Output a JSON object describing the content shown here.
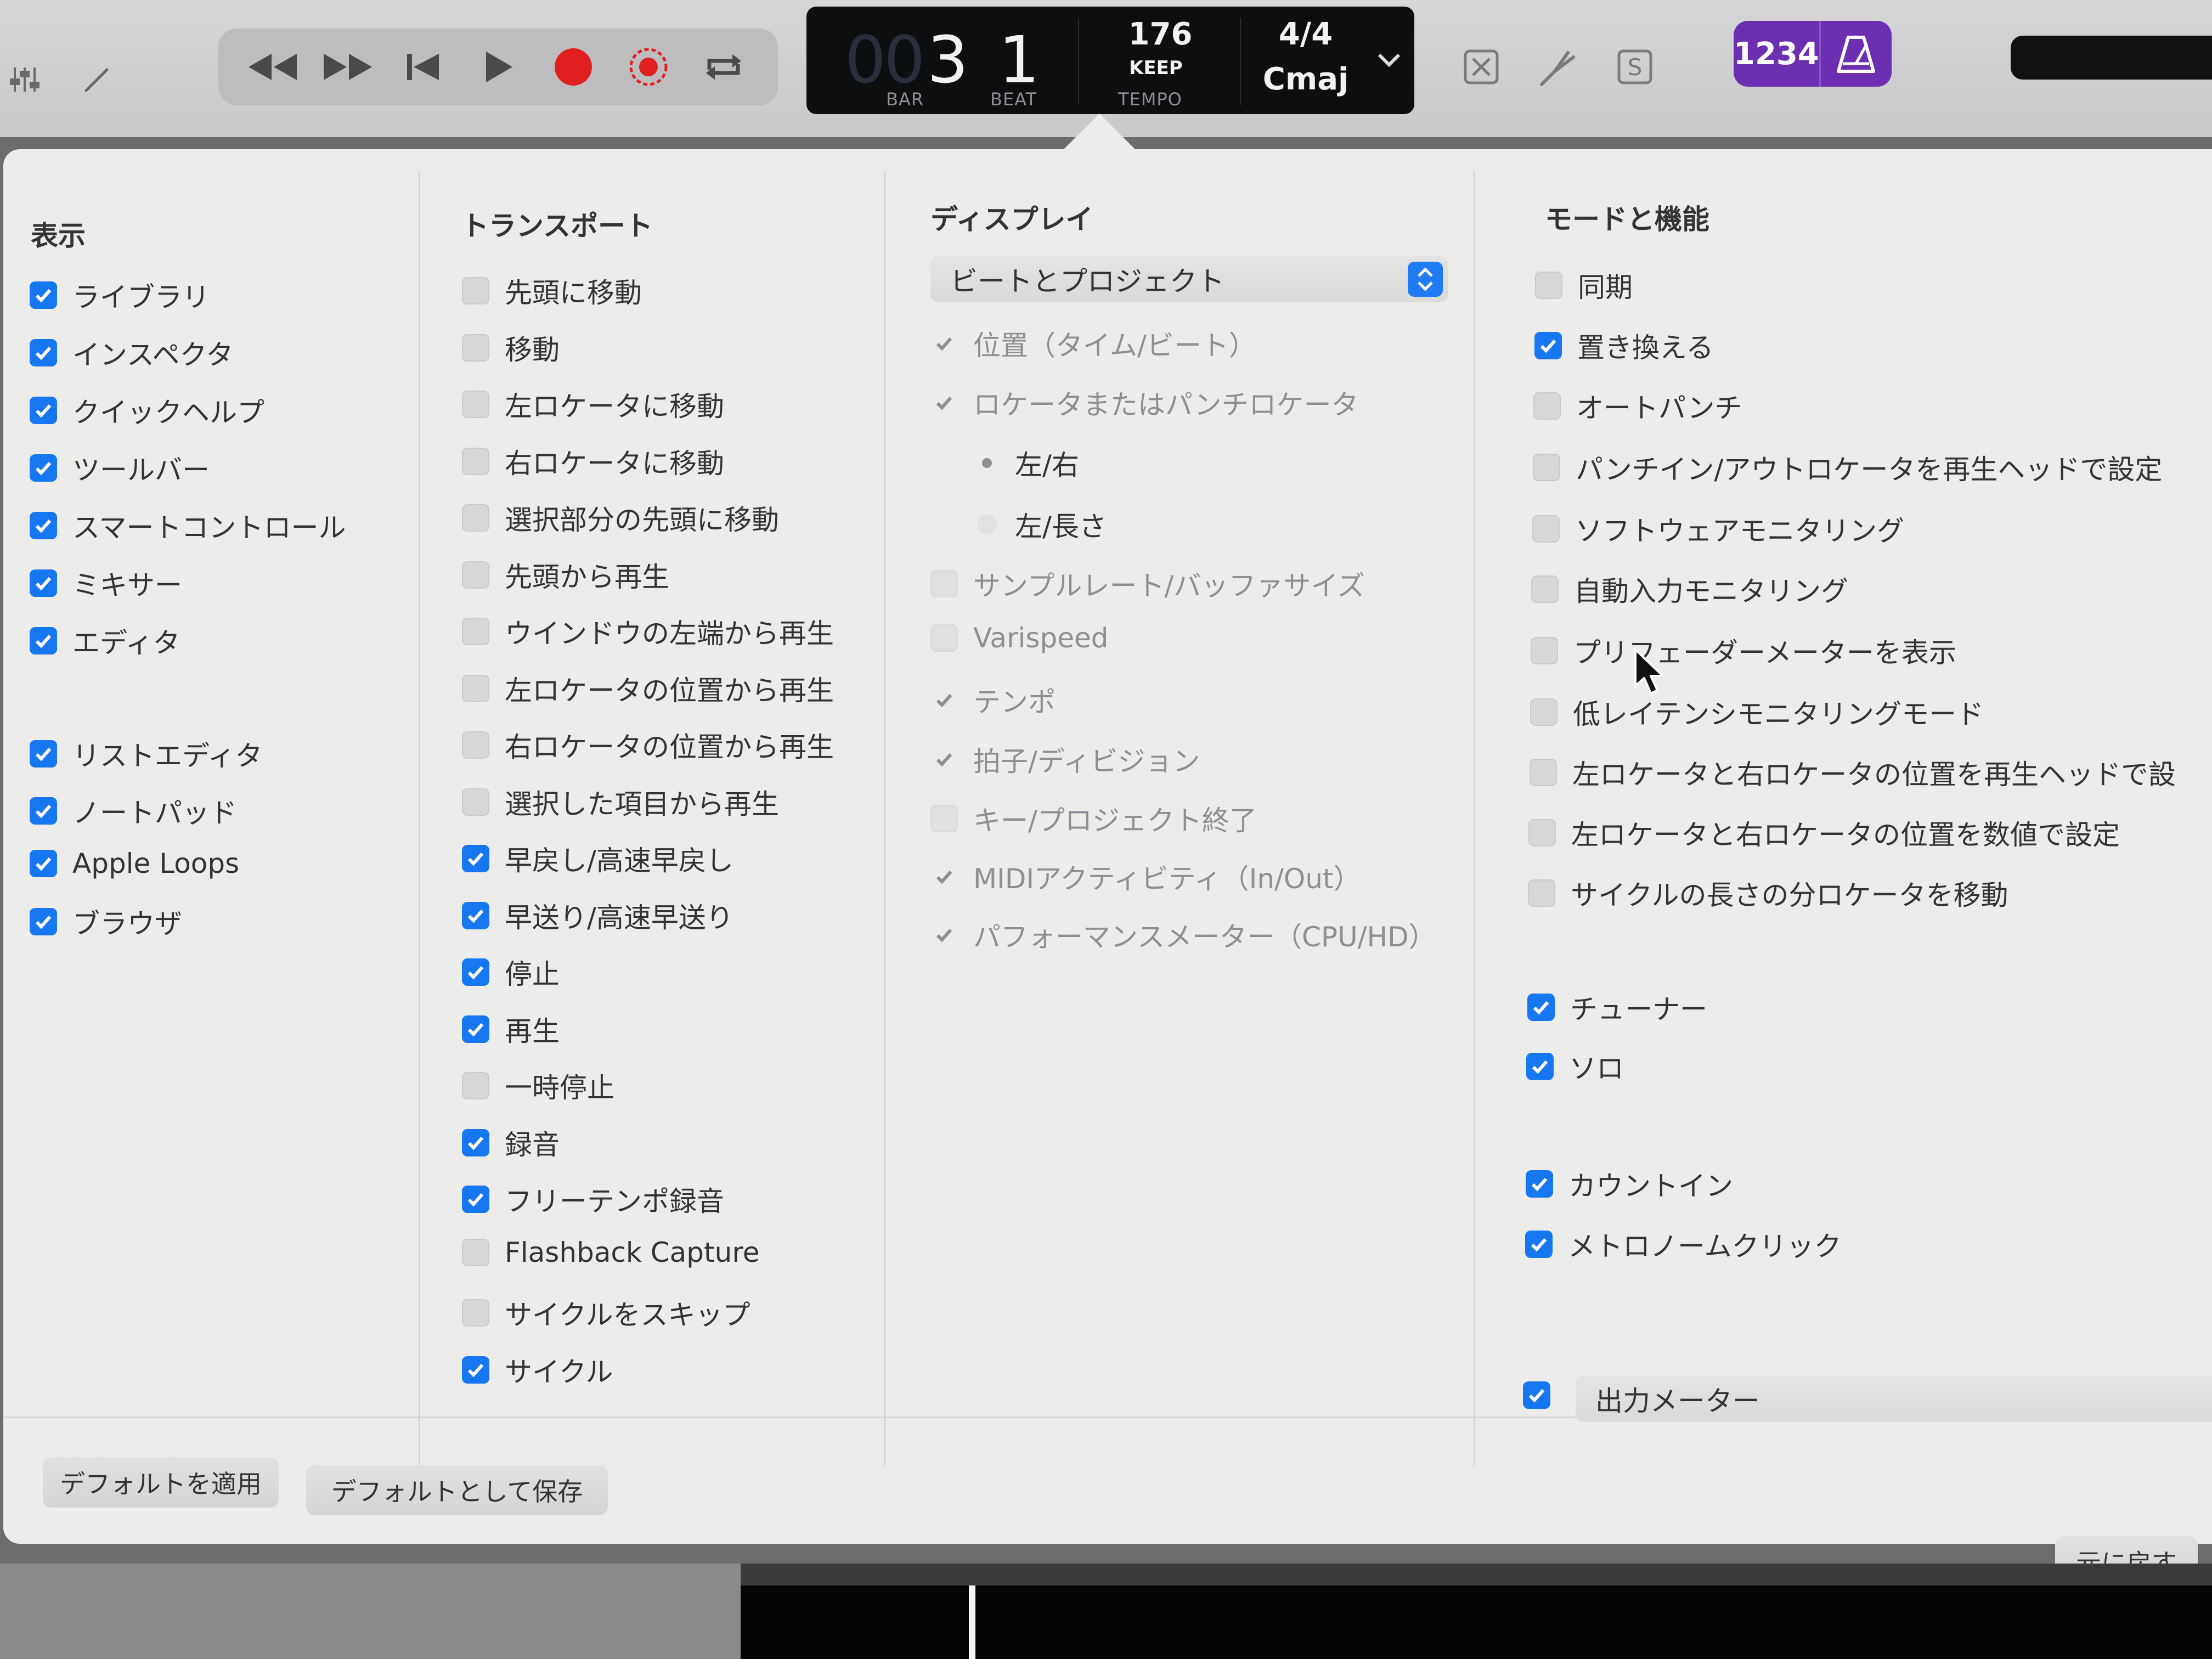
{
  "control_bar": {
    "lcd": {
      "bar_prefix": "00",
      "bar_value": "3",
      "beat_value": "1",
      "bar_label": "BAR",
      "beat_label": "BEAT",
      "tempo_value": "176",
      "tempo_mode": "KEEP",
      "tempo_label": "TEMPO",
      "time_signature": "4/4",
      "key": "Cmaj"
    },
    "purple_buttons": {
      "count_in_label": "1234"
    },
    "accent_color": "#6d2fb1",
    "record_color": "#e02020"
  },
  "popover": {
    "columns": {
      "view": {
        "title": "表示",
        "items": [
          {
            "label": "ライブラリ",
            "checked": true
          },
          {
            "label": "インスペクタ",
            "checked": true
          },
          {
            "label": "クイックヘルプ",
            "checked": true
          },
          {
            "label": "ツールバー",
            "checked": true
          },
          {
            "label": "スマートコントロール",
            "checked": true
          },
          {
            "label": "ミキサー",
            "checked": true
          },
          {
            "label": "エディタ",
            "checked": true
          },
          {
            "label": "リストエディタ",
            "checked": true
          },
          {
            "label": "ノートパッド",
            "checked": true
          },
          {
            "label": "Apple Loops",
            "checked": true
          },
          {
            "label": "ブラウザ",
            "checked": true
          }
        ]
      },
      "transport": {
        "title": "トランスポート",
        "items": [
          {
            "label": "先頭に移動",
            "checked": false
          },
          {
            "label": "移動",
            "checked": false
          },
          {
            "label": "左ロケータに移動",
            "checked": false
          },
          {
            "label": "右ロケータに移動",
            "checked": false
          },
          {
            "label": "選択部分の先頭に移動",
            "checked": false
          },
          {
            "label": "先頭から再生",
            "checked": false
          },
          {
            "label": "ウインドウの左端から再生",
            "checked": false
          },
          {
            "label": "左ロケータの位置から再生",
            "checked": false
          },
          {
            "label": "右ロケータの位置から再生",
            "checked": false
          },
          {
            "label": "選択した項目から再生",
            "checked": false
          },
          {
            "label": "早戻し/高速早戻し",
            "checked": true
          },
          {
            "label": "早送り/高速早送り",
            "checked": true
          },
          {
            "label": "停止",
            "checked": true
          },
          {
            "label": "再生",
            "checked": true
          },
          {
            "label": "一時停止",
            "checked": false
          },
          {
            "label": "録音",
            "checked": true
          },
          {
            "label": "フリーテンポ録音",
            "checked": true
          },
          {
            "label": "Flashback Capture",
            "checked": false
          },
          {
            "label": "サイクルをスキップ",
            "checked": false
          },
          {
            "label": "サイクル",
            "checked": true
          }
        ]
      },
      "display": {
        "title": "ディスプレイ",
        "select_value": "ビートとプロジェクト",
        "items": [
          {
            "label": "位置（タイム/ビート）",
            "state": "checked-disabled"
          },
          {
            "label": "ロケータまたはパンチロケータ",
            "state": "checked-disabled"
          },
          {
            "label": "左/右",
            "state": "radio-on"
          },
          {
            "label": "左/長さ",
            "state": "radio-off"
          },
          {
            "label": "サンプルレート/バッファサイズ",
            "state": "unchecked-disabled"
          },
          {
            "label": "Varispeed",
            "state": "unchecked-disabled"
          },
          {
            "label": "テンポ",
            "state": "checked-disabled"
          },
          {
            "label": "拍子/ディビジョン",
            "state": "checked-disabled"
          },
          {
            "label": "キー/プロジェクト終了",
            "state": "unchecked-disabled"
          },
          {
            "label": "MIDIアクティビティ（In/Out）",
            "state": "checked-disabled"
          },
          {
            "label": "パフォーマンスメーター（CPU/HD）",
            "state": "checked-disabled"
          }
        ]
      },
      "modes": {
        "title": "モードと機能",
        "items": [
          {
            "label": "同期",
            "checked": false
          },
          {
            "label": "置き換える",
            "checked": true
          },
          {
            "label": "オートパンチ",
            "checked": false
          },
          {
            "label": "パンチイン/アウトロケータを再生ヘッドで設定",
            "checked": false
          },
          {
            "label": "ソフトウェアモニタリング",
            "checked": false
          },
          {
            "label": "自動入力モニタリング",
            "checked": false
          },
          {
            "label": "プリフェーダーメーターを表示",
            "checked": false
          },
          {
            "label": "低レイテンシモニタリングモード",
            "checked": false
          },
          {
            "label": "左ロケータと右ロケータの位置を再生ヘッドで設",
            "checked": false
          },
          {
            "label": "左ロケータと右ロケータの位置を数値で設定",
            "checked": false
          },
          {
            "label": "サイクルの長さの分ロケータを移動",
            "checked": false
          },
          {
            "label": "チューナー",
            "checked": true
          },
          {
            "label": "ソロ",
            "checked": true
          },
          {
            "label": "カウントイン",
            "checked": true
          },
          {
            "label": "メトロノームクリック",
            "checked": true
          }
        ],
        "output_meter": {
          "label": "出力メーター",
          "checked": true
        }
      }
    },
    "footer": {
      "apply_default": "デフォルトを適用",
      "save_default": "デフォルトとして保存",
      "revert": "元に戻す"
    }
  }
}
